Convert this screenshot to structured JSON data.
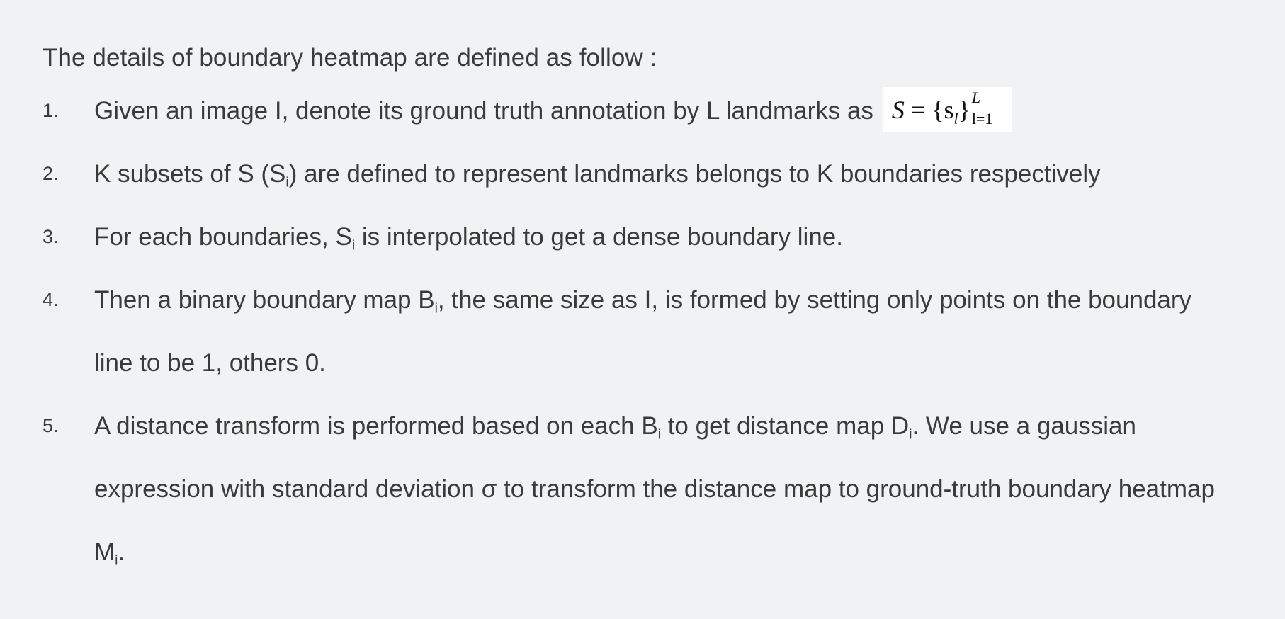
{
  "intro": "The details of boundary heatmap are defined as follow :",
  "formula": {
    "lhs": "S",
    "equals": "=",
    "set": "{s",
    "set_sub": "l",
    "close": "}",
    "upper": "L",
    "lower": "l=1"
  },
  "steps": [
    {
      "number": "1.",
      "text": "Given an image I, denote its ground truth annotation by L landmarks as"
    },
    {
      "number": "2.",
      "text_a": "K subsets of S (S",
      "sub_a": "i",
      "text_b": ") are defined to represent landmarks belongs to K boundaries respectively"
    },
    {
      "number": "3.",
      "text_a": "For each boundaries, S",
      "sub_a": "i",
      "text_b": " is interpolated to get a dense boundary line."
    },
    {
      "number": "4.",
      "text_a": "Then a binary boundary map B",
      "sub_a": "i",
      "text_b": ", the same size as I, is formed by setting only points on the boundary line to be 1, others 0."
    },
    {
      "number": "5.",
      "text_a": "A distance transform is performed based on each B",
      "sub_a": "i",
      "text_b": " to get distance map D",
      "sub_b": "i",
      "text_c": ". We use a gaussian expression with standard deviation σ to transform the distance map to ground-truth boundary heatmap M",
      "sub_c": "i",
      "text_d": "."
    }
  ]
}
